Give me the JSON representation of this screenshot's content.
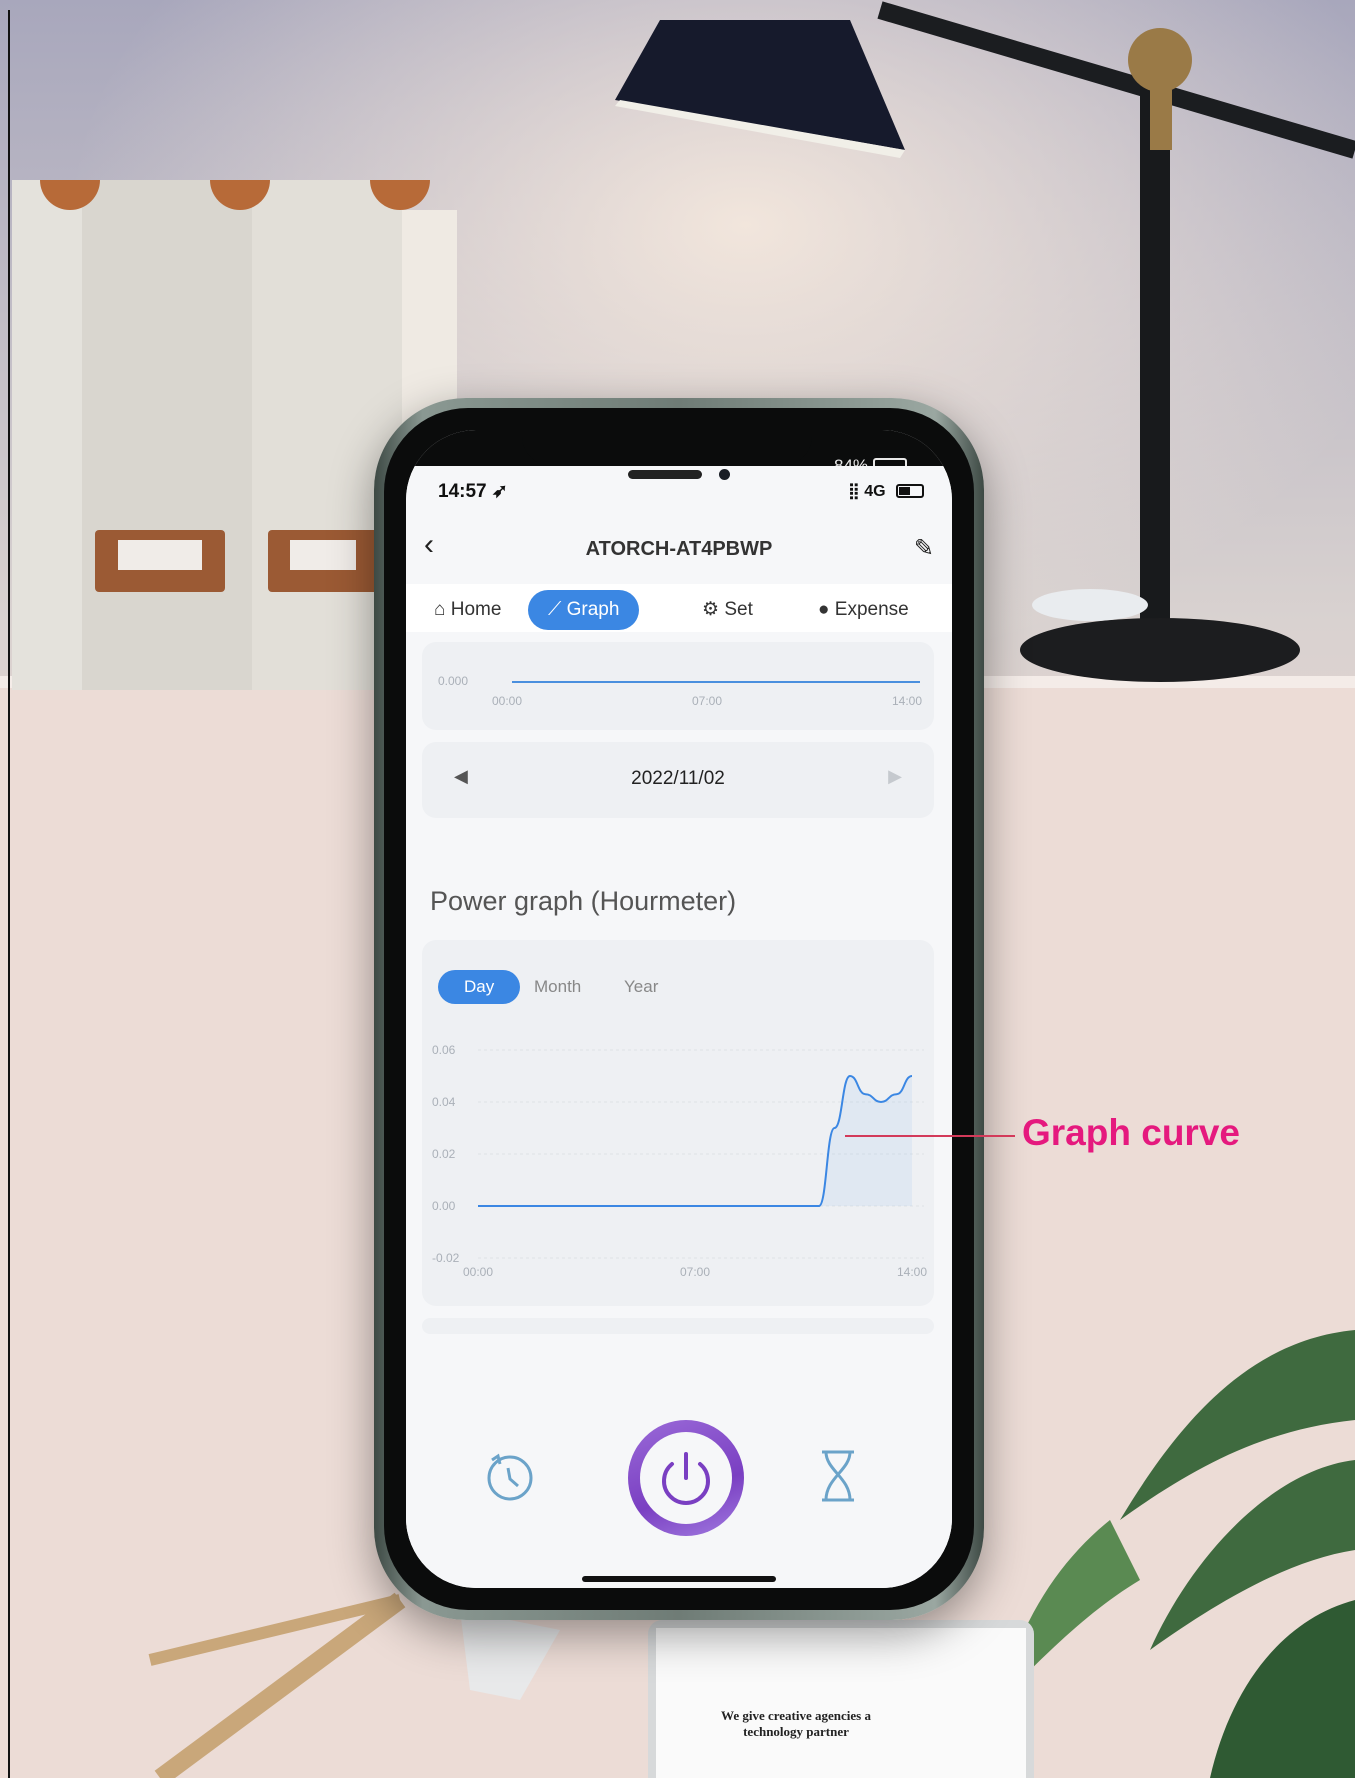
{
  "status_bar": {
    "time": "14:57",
    "network": "4G"
  },
  "outer_phone": {
    "battery": "84%"
  },
  "header": {
    "title": "ATORCH-AT4PBWP"
  },
  "tabs": [
    {
      "label": "Home",
      "icon": "home-icon"
    },
    {
      "label": "Graph",
      "icon": "line-chart-icon"
    },
    {
      "label": "Set",
      "icon": "gear-icon"
    },
    {
      "label": "Expense",
      "icon": "coin-icon"
    }
  ],
  "mini_chart": {
    "y_label": "0.000",
    "x_labels": [
      "00:00",
      "07:00",
      "14:00"
    ]
  },
  "date_nav": {
    "date": "2022/11/02"
  },
  "power_section": {
    "title": "Power graph (Hourmeter)"
  },
  "period_tabs": [
    "Day",
    "Month",
    "Year"
  ],
  "chart_data": {
    "type": "area",
    "title": "",
    "x": [
      "00:00",
      "01:00",
      "02:00",
      "03:00",
      "04:00",
      "05:00",
      "06:00",
      "07:00",
      "08:00",
      "09:00",
      "10:00",
      "11:00",
      "11:30",
      "12:00",
      "12:30",
      "13:00",
      "13:30",
      "14:00"
    ],
    "values": [
      0,
      0,
      0,
      0,
      0,
      0,
      0,
      0,
      0,
      0,
      0,
      0,
      0.03,
      0.05,
      0.043,
      0.04,
      0.043,
      0.05
    ],
    "x_ticks": [
      "00:00",
      "07:00",
      "14:00"
    ],
    "y_ticks": [
      "0.06",
      "0.04",
      "0.02",
      "0.00",
      "-0.02"
    ],
    "ylim": [
      -0.02,
      0.06
    ],
    "grid": true,
    "color": "#3b87e3"
  },
  "annotation": {
    "label": "Graph curve",
    "color": "#e5197e"
  },
  "laptop": {
    "caption": "We give creative agencies a technology partner"
  },
  "colors": {
    "accent": "#3b87e3",
    "power": "#7a3fc2"
  }
}
